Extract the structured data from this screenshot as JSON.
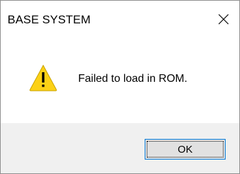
{
  "window": {
    "title": "BASE SYSTEM"
  },
  "title_bar": {
    "close_icon": "close-icon"
  },
  "content": {
    "icon": "warning-icon",
    "message": "Failed to load in ROM."
  },
  "footer": {
    "ok_label": "OK"
  },
  "colors": {
    "warning_fill": "#fcd116",
    "accent_border": "#0078d7",
    "footer_bg": "#f0f0f0"
  }
}
